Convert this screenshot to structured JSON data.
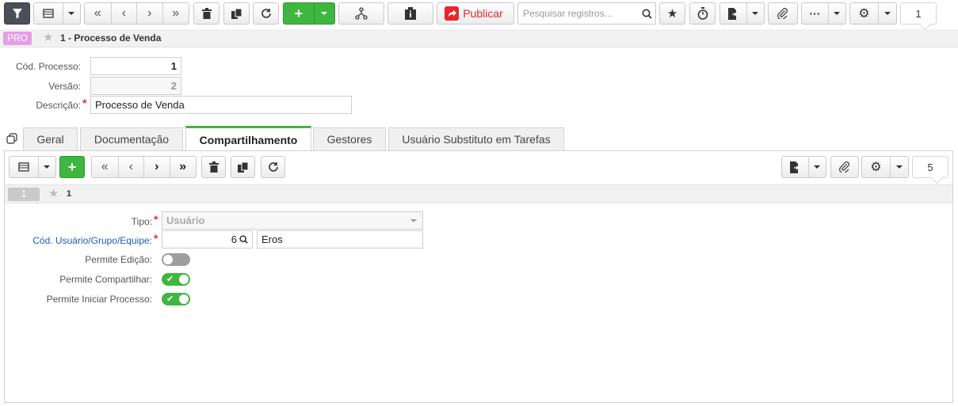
{
  "toolbar": {
    "publish_label": "Publicar",
    "search_placeholder": "Pesquisar registros...",
    "record_count": "1"
  },
  "record": {
    "badge": "PRO",
    "title": "1 - Processo de Venda"
  },
  "form": {
    "cod_processo_label": "Cód. Processo:",
    "cod_processo_value": "1",
    "versao_label": "Versão:",
    "versao_value": "2",
    "descricao_label": "Descrição:",
    "descricao_value": "Processo de Venda"
  },
  "tabs": [
    {
      "label": "Geral"
    },
    {
      "label": "Documentação"
    },
    {
      "label": "Compartilhamento"
    },
    {
      "label": "Gestores"
    },
    {
      "label": "Usuário Substituto em Tarefas"
    }
  ],
  "subtoolbar": {
    "record_count": "5"
  },
  "subrecord": {
    "badge": "1",
    "title": "1"
  },
  "share": {
    "tipo_label": "Tipo:",
    "tipo_value": "Usuário",
    "cod_label": "Cód. Usuário/Grupo/Equipe:",
    "cod_value": "6",
    "cod_name": "Eros",
    "permite_edicao_label": "Permite Edição:",
    "permite_edicao": false,
    "permite_compartilhar_label": "Permite Compartilhar:",
    "permite_compartilhar": true,
    "permite_iniciar_label": "Permite Iniciar Processo:",
    "permite_iniciar": true
  },
  "colors": {
    "accent_green": "#3fb63f",
    "publish_red": "#e8262b",
    "badge_pink": "#e59ee5",
    "link_blue": "#1a5fb4"
  }
}
